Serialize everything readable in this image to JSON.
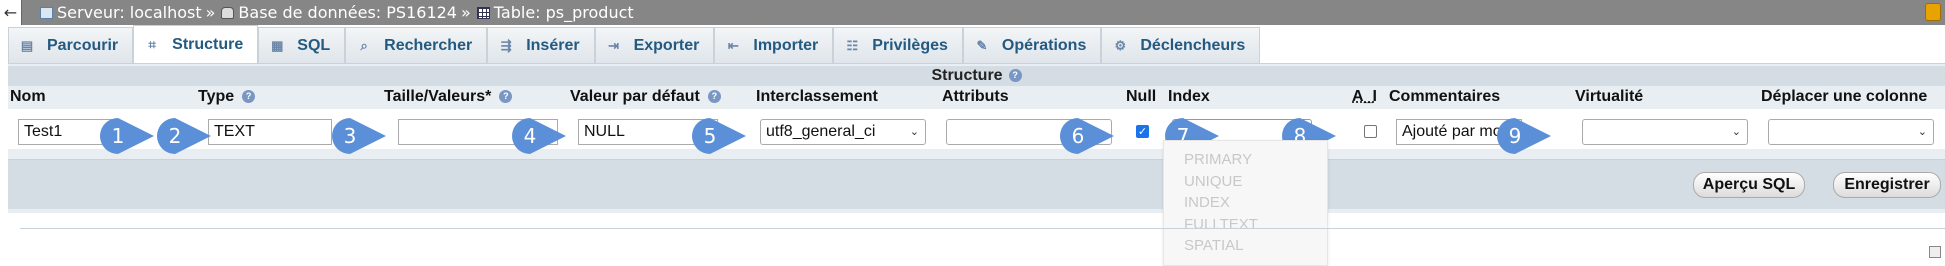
{
  "window": {
    "back_label": "←",
    "breadcrumb": [
      {
        "icon": "server-icon",
        "label": "Serveur: localhost"
      },
      {
        "icon": "database-icon",
        "label": "Base de données: PS16124"
      },
      {
        "icon": "table-icon",
        "label": "Table: ps_product"
      }
    ],
    "separator": "»"
  },
  "tabs": [
    {
      "label": "Parcourir",
      "icon": "browse-icon",
      "active": false
    },
    {
      "label": "Structure",
      "icon": "structure-icon",
      "active": true
    },
    {
      "label": "SQL",
      "icon": "sql-icon",
      "active": false
    },
    {
      "label": "Rechercher",
      "icon": "search-icon",
      "active": false
    },
    {
      "label": "Insérer",
      "icon": "insert-icon",
      "active": false
    },
    {
      "label": "Exporter",
      "icon": "export-icon",
      "active": false
    },
    {
      "label": "Importer",
      "icon": "import-icon",
      "active": false
    },
    {
      "label": "Privilèges",
      "icon": "privileges-icon",
      "active": false
    },
    {
      "label": "Opérations",
      "icon": "wrench-icon",
      "active": false
    },
    {
      "label": "Déclencheurs",
      "icon": "triggers-icon",
      "active": false
    }
  ],
  "structure": {
    "title": "Structure",
    "columns": {
      "nom": "Nom",
      "type": "Type",
      "taille": "Taille/Valeurs*",
      "defaut": "Valeur par défaut",
      "interclassement": "Interclassement",
      "attributs": "Attributs",
      "null": "Null",
      "index": "Index",
      "ai": "A_I",
      "commentaires": "Commentaires",
      "virtualite": "Virtualité",
      "deplacer": "Déplacer une colonne"
    },
    "row": {
      "nom": "Test1",
      "type": "TEXT",
      "taille": "",
      "defaut": "NULL",
      "interclassement": "utf8_general_ci",
      "attributs": "",
      "null_checked": true,
      "index": "",
      "ai_checked": false,
      "commentaires": "Ajouté par moi",
      "virtualite": "",
      "deplacer": ""
    },
    "index_options": [
      "PRIMARY",
      "UNIQUE",
      "INDEX",
      "FULLTEXT",
      "SPATIAL"
    ],
    "badges": [
      "1",
      "2",
      "3",
      "4",
      "5",
      "6",
      "7",
      "8",
      "9"
    ],
    "badge_color": "#5b8fd8",
    "buttons": {
      "preview_sql": "Aperçu SQL",
      "save": "Enregistrer"
    }
  }
}
